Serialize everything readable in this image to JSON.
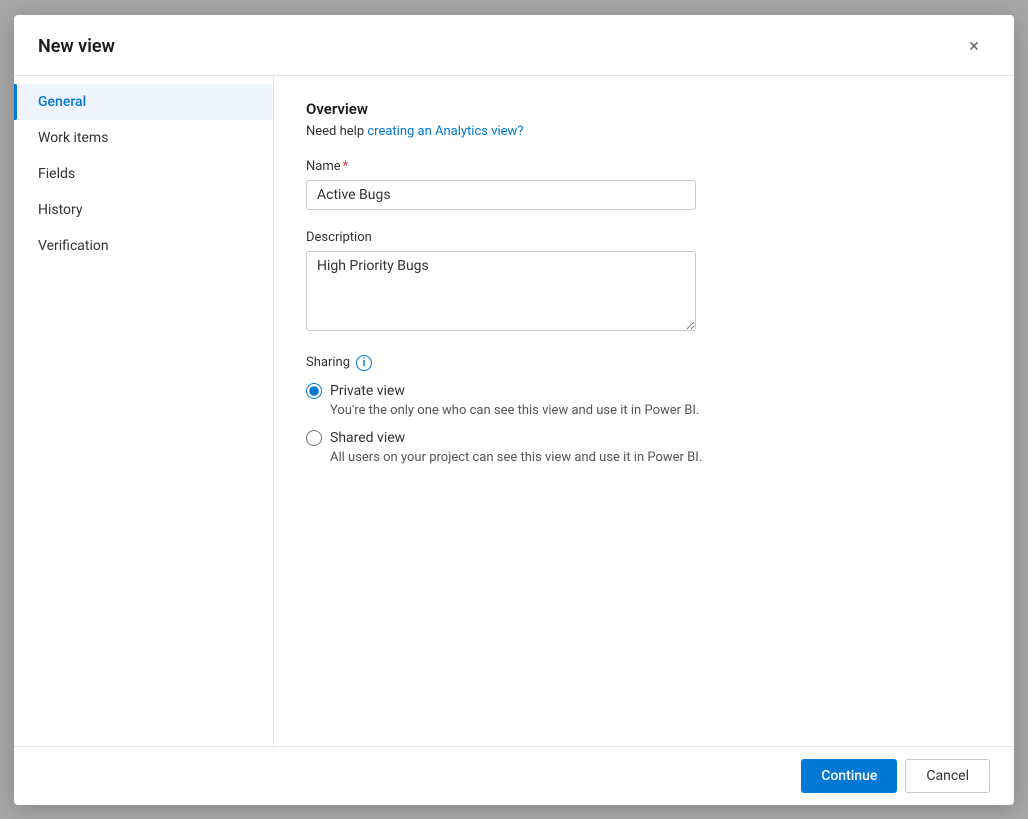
{
  "dialog": {
    "title": "New view",
    "close_label": "×"
  },
  "sidebar": {
    "items": [
      {
        "id": "general",
        "label": "General",
        "active": true
      },
      {
        "id": "work-items",
        "label": "Work items",
        "active": false
      },
      {
        "id": "fields",
        "label": "Fields",
        "active": false
      },
      {
        "id": "history",
        "label": "History",
        "active": false
      },
      {
        "id": "verification",
        "label": "Verification",
        "active": false
      }
    ]
  },
  "content": {
    "section_title": "Overview",
    "help_prefix": "Need help ",
    "help_link_text": "creating an Analytics view?",
    "name_label": "Name",
    "name_required": "*",
    "name_value": "Active Bugs",
    "name_placeholder": "",
    "description_label": "Description",
    "description_value": "High Priority Bugs",
    "sharing_label": "Sharing",
    "info_icon": "i",
    "sharing_options": [
      {
        "id": "private",
        "label": "Private view",
        "description": "You're the only one who can see this view and use it in Power BI.",
        "checked": true
      },
      {
        "id": "shared",
        "label": "Shared view",
        "description": "All users on your project can see this view and use it in Power BI.",
        "checked": false
      }
    ]
  },
  "footer": {
    "continue_label": "Continue",
    "cancel_label": "Cancel"
  }
}
